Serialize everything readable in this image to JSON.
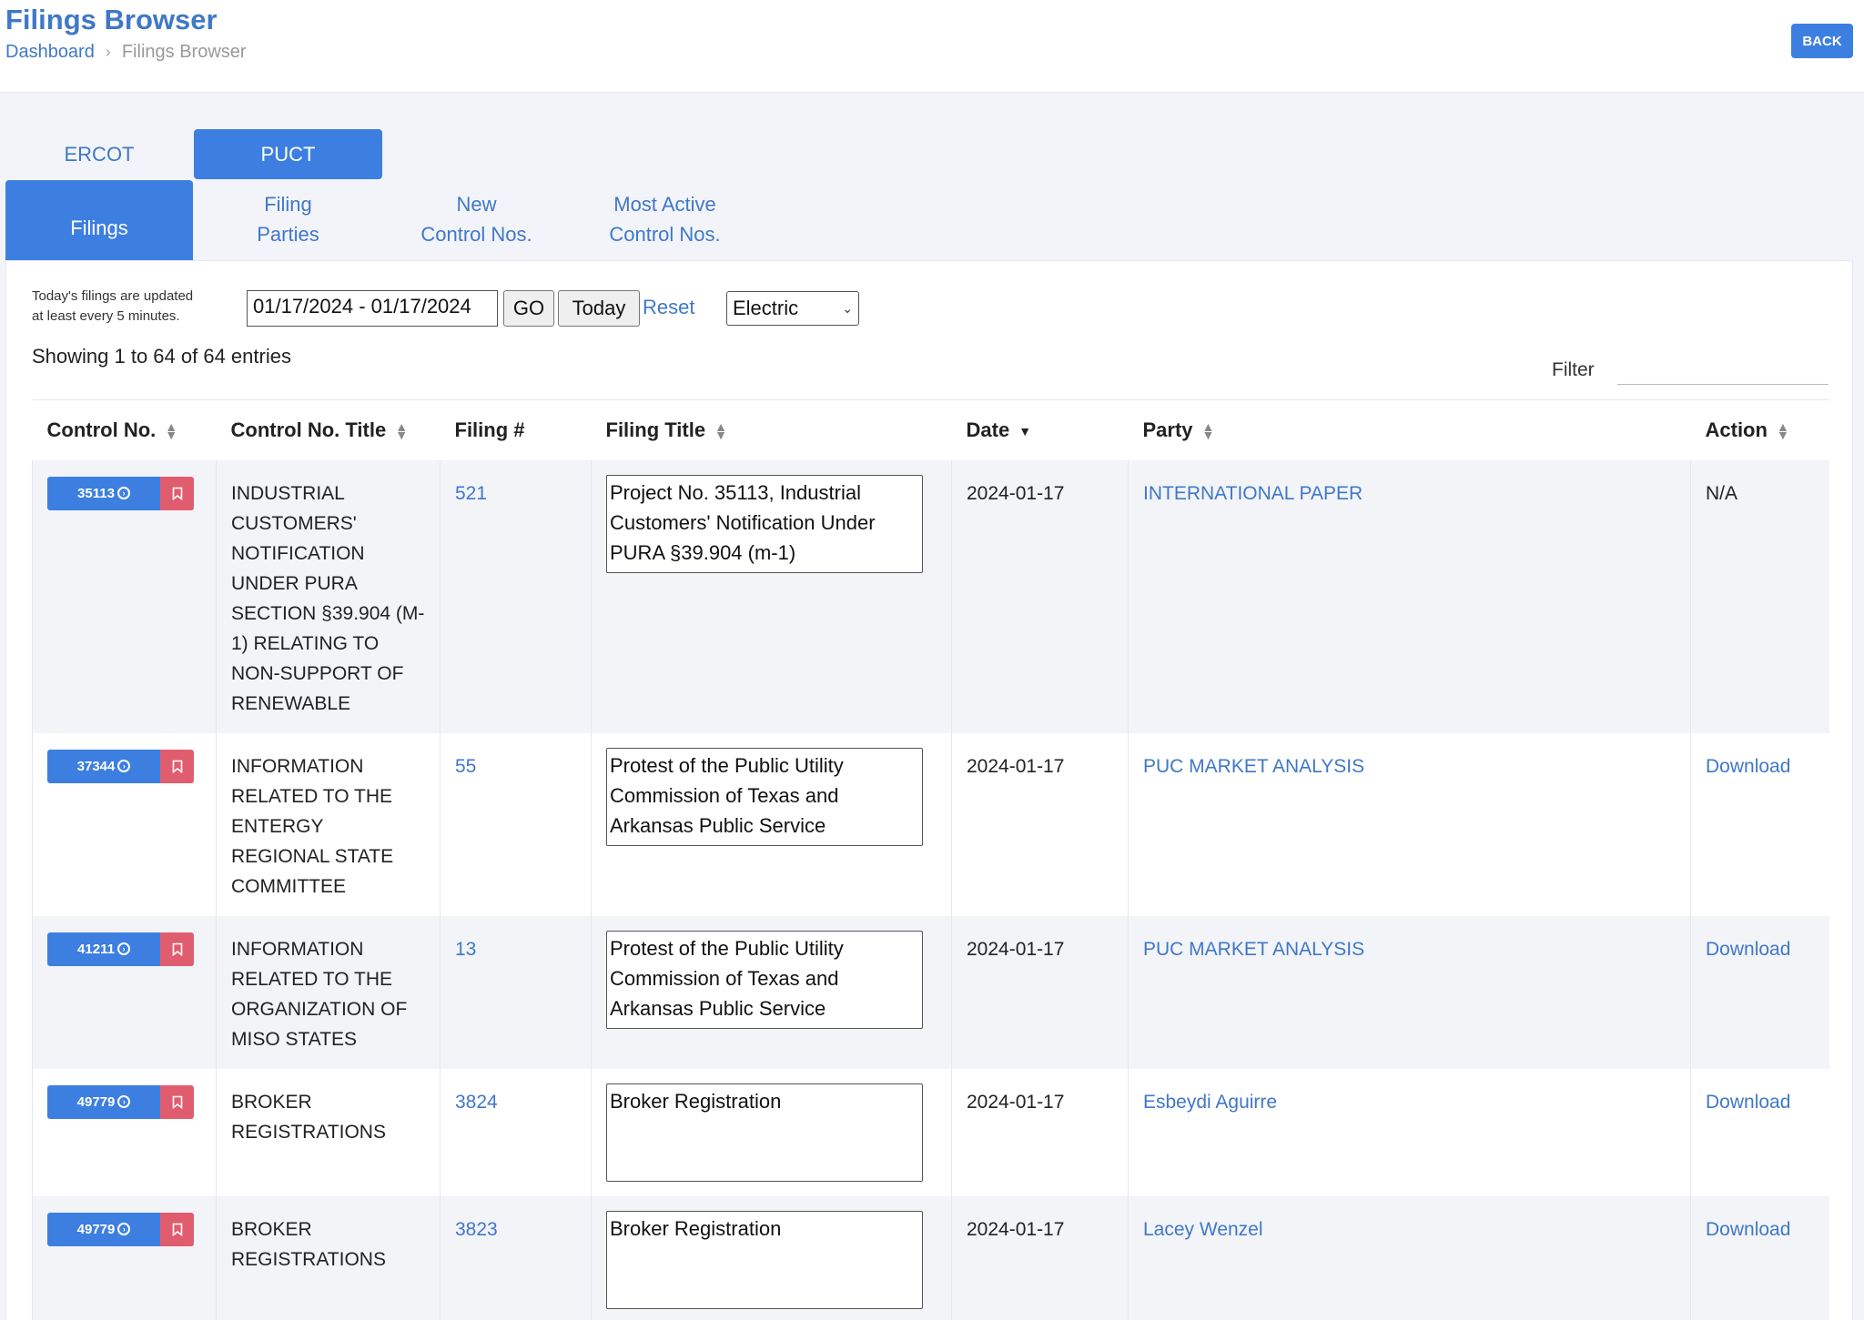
{
  "header": {
    "title": "Filings Browser",
    "breadcrumb": {
      "home": "Dashboard",
      "current": "Filings Browser"
    },
    "back_label": "BACK"
  },
  "tabs": {
    "top": [
      {
        "label": "ERCOT",
        "active": false
      },
      {
        "label": "PUCT",
        "active": true
      }
    ],
    "sub": [
      {
        "line1": "Filings",
        "line2": "",
        "active": true
      },
      {
        "line1": "Filing",
        "line2": "Parties",
        "active": false
      },
      {
        "line1": "New",
        "line2": "Control Nos.",
        "active": false
      },
      {
        "line1": "Most Active",
        "line2": "Control Nos.",
        "active": false
      }
    ]
  },
  "toolbar": {
    "note_line1": "Today's filings are updated",
    "note_line2": "at least every 5 minutes.",
    "date_range": "01/17/2024 - 01/17/2024",
    "go_label": "GO",
    "today_label": "Today",
    "reset_label": "Reset",
    "market_select": "Electric"
  },
  "table": {
    "showing": "Showing 1 to 64 of 64 entries",
    "filter_label": "Filter",
    "columns": [
      "Control No.",
      "Control No. Title",
      "Filing #",
      "Filing Title",
      "Date",
      "Party",
      "Action"
    ],
    "rows": [
      {
        "control_no": "35113",
        "control_title": "INDUSTRIAL CUSTOMERS' NOTIFICATION UNDER PURA SECTION §39.904 (m-1) RELATING TO NON-SUPPORT OF RENEWABLE",
        "filing_no": "521",
        "filing_title": "Project No. 35113, Industrial Customers' Notification Under PURA §39.904 (m-1)",
        "date": "2024-01-17",
        "party": "INTERNATIONAL PAPER",
        "action": "N/A"
      },
      {
        "control_no": "37344",
        "control_title": "INFORMATION RELATED TO THE ENTERGY REGIONAL STATE COMMITTEE",
        "filing_no": "55",
        "filing_title": "Protest of the Public Utility Commission of Texas and Arkansas Public Service",
        "date": "2024-01-17",
        "party": "PUC MARKET ANALYSIS",
        "action": "Download"
      },
      {
        "control_no": "41211",
        "control_title": "INFORMATION RELATED TO THE ORGANIZATION OF MISO STATES",
        "filing_no": "13",
        "filing_title": "Protest of the Public Utility Commission of Texas and Arkansas Public Service",
        "date": "2024-01-17",
        "party": "PUC MARKET ANALYSIS",
        "action": "Download"
      },
      {
        "control_no": "49779",
        "control_title": "BROKER REGISTRATIONS",
        "filing_no": "3824",
        "filing_title": "Broker Registration",
        "date": "2024-01-17",
        "party": "Esbeydi Aguirre",
        "action": "Download"
      },
      {
        "control_no": "49779",
        "control_title": "BROKER REGISTRATIONS",
        "filing_no": "3823",
        "filing_title": "Broker Registration",
        "date": "2024-01-17",
        "party": "Lacey Wenzel",
        "action": "Download"
      }
    ]
  }
}
